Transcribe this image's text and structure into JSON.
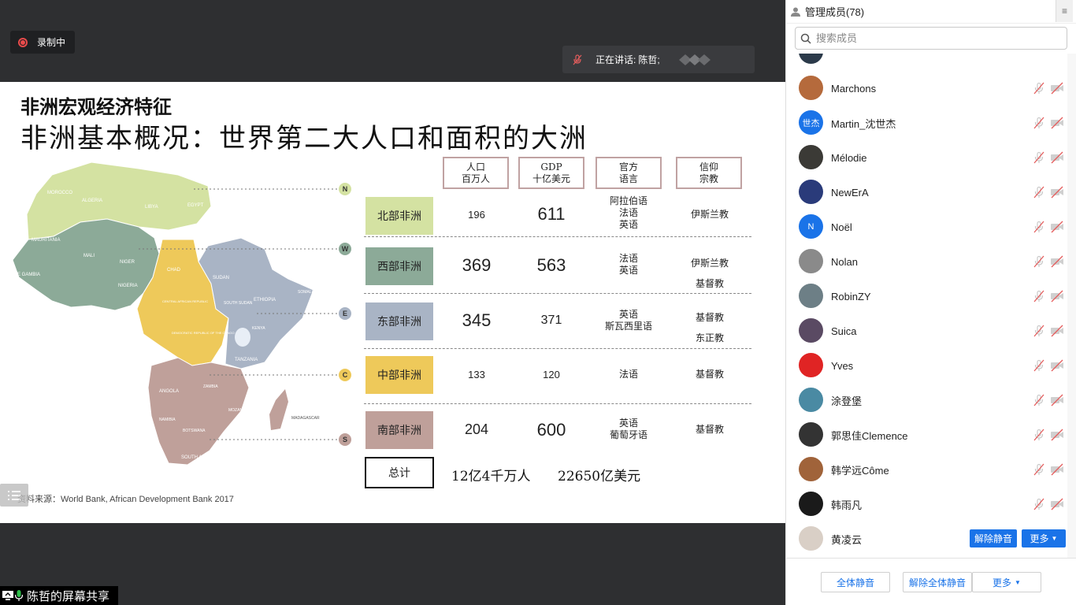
{
  "recording": {
    "label": "录制中"
  },
  "speaking": {
    "label": "正在讲话:",
    "name": "陈哲;"
  },
  "slide": {
    "subtitle": "非洲宏观经济特征",
    "title": "非洲基本概况：世界第二大人口和面积的大洲",
    "columns": [
      {
        "line1": "人口",
        "line2": "百万人"
      },
      {
        "line1": "GDP",
        "line2": "十亿美元"
      },
      {
        "line1": "官方",
        "line2": "语言"
      },
      {
        "line1": "信仰",
        "line2": "宗教"
      }
    ],
    "rows": [
      {
        "region": "北部非洲",
        "color": "#d4e2a2",
        "population": "196",
        "gdp": "611",
        "lang1": "阿拉伯语",
        "lang2": "法语",
        "lang3": "英语",
        "rel1": "伊斯兰教",
        "rel2": ""
      },
      {
        "region": "西部非洲",
        "color": "#8caa98",
        "population": "369",
        "gdp": "563",
        "lang1": "法语",
        "lang2": "英语",
        "lang3": "",
        "rel1": "伊斯兰教",
        "rel2": "基督教"
      },
      {
        "region": "东部非洲",
        "color": "#a9b4c5",
        "population": "345",
        "gdp": "371",
        "lang1": "英语",
        "lang2": "斯瓦西里语",
        "lang3": "",
        "rel1": "基督教",
        "rel2": "东正教"
      },
      {
        "region": "中部非洲",
        "color": "#eec95a",
        "population": "133",
        "gdp": "120",
        "lang1": "法语",
        "lang2": "",
        "lang3": "",
        "rel1": "基督教",
        "rel2": ""
      },
      {
        "region": "南部非洲",
        "color": "#bfa09a",
        "population": "204",
        "gdp": "600",
        "lang1": "英语",
        "lang2": "葡萄牙语",
        "lang3": "",
        "rel1": "基督教",
        "rel2": ""
      }
    ],
    "total": {
      "label": "总计",
      "population": "12亿4千万人",
      "gdp": "22650亿美元"
    },
    "source": "资料来源：World Bank, African Development Bank 2017",
    "map_markers": [
      "N",
      "W",
      "E",
      "C",
      "S"
    ],
    "map_labels": {
      "morocco": "MOROCCO",
      "algeria": "ALGERIA",
      "libya": "LIBYA",
      "egypt": "EGYPT",
      "mauritania": "MAURITANIA",
      "mali": "MALI",
      "niger": "NIGER",
      "nigeria": "NIGERIA",
      "chad": "CHAD",
      "sudan": "SUDAN",
      "south_sudan": "SOUTH SUDAN",
      "ethiopia": "ETHIOPIA",
      "somalia": "SOMALIA",
      "kenya": "KENYA",
      "tanzania": "TANZANIA",
      "car": "CENTRAL AFRICAN REPUBLIC",
      "drc": "DEMOCRATIC REPUBLIC OF THE CONGO",
      "angola": "ANGOLA",
      "zambia": "ZAMBIA",
      "namibia": "NAMIBIA",
      "botswana": "BOTSWANA",
      "south_africa": "SOUTH AFRICA",
      "mozambique": "MOZAMBIQUE",
      "madagascar": "MADAGASCAR",
      "gambia": "THE GAMBIA"
    }
  },
  "share_label": "陈哲的屏幕共享",
  "panel": {
    "title": "管理成员(78)",
    "search_placeholder": "搜索成员",
    "members": [
      {
        "name": "Marchons",
        "avatar_color": "#b56a3c",
        "avatar_text": ""
      },
      {
        "name": "Martin_沈世杰",
        "avatar_color": "#1a73e8",
        "avatar_text": "世杰"
      },
      {
        "name": "Mélodie",
        "avatar_color": "#3b3a36",
        "avatar_text": ""
      },
      {
        "name": "NewErA",
        "avatar_color": "#2a3b7a",
        "avatar_text": ""
      },
      {
        "name": "Noël",
        "avatar_color": "#1a73e8",
        "avatar_text": "N"
      },
      {
        "name": "Nolan",
        "avatar_color": "#8a8a8a",
        "avatar_text": ""
      },
      {
        "name": "RobinZY",
        "avatar_color": "#6d7f86",
        "avatar_text": ""
      },
      {
        "name": "Suica",
        "avatar_color": "#5a4a63",
        "avatar_text": ""
      },
      {
        "name": "Yves",
        "avatar_color": "#e02424",
        "avatar_text": ""
      },
      {
        "name": "涂登堡",
        "avatar_color": "#4a8aa3",
        "avatar_text": ""
      },
      {
        "name": "郭思佳Clemence",
        "avatar_color": "#333333",
        "avatar_text": ""
      },
      {
        "name": "韩学远Côme",
        "avatar_color": "#a0633a",
        "avatar_text": ""
      },
      {
        "name": "韩雨凡",
        "avatar_color": "#1a1a1a",
        "avatar_text": ""
      },
      {
        "name": "黄凌云",
        "avatar_color": "#d9cfc6",
        "avatar_text": ""
      }
    ],
    "unmute_label": "解除静音",
    "more_label": "更多",
    "footer": {
      "mute_all": "全体静音",
      "unmute_all": "解除全体静音",
      "more": "更多"
    }
  },
  "colors": {
    "accent": "#1a73e8",
    "record": "#e94b4b",
    "muted": "#e45d5d"
  }
}
